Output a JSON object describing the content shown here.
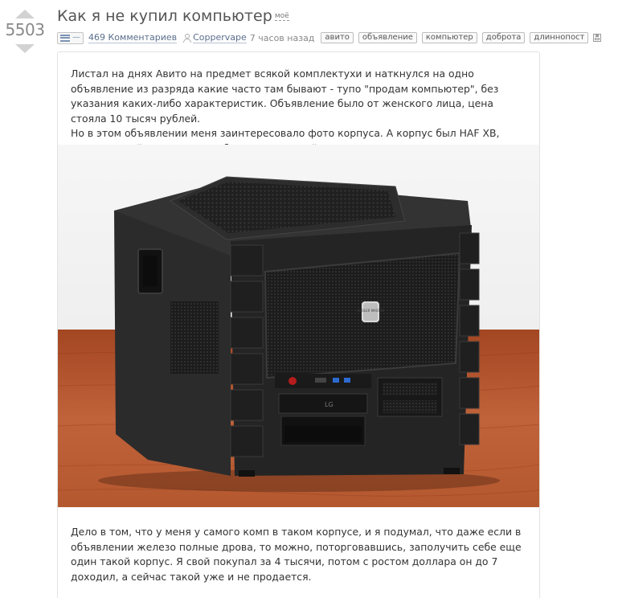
{
  "post": {
    "rating": "5503",
    "title": "Как я не купил компьютер",
    "mine_label": "моё",
    "comments_label": "469 Комментариев",
    "author": "Coppervape",
    "time": "7 часов назад",
    "tags": [
      "авито",
      "объявление",
      "компьютер",
      "доброта",
      "длиннопост"
    ],
    "toggle_symbol": "—"
  },
  "content": {
    "paragraph1": "Листал на днях Авито на предмет всякой комплектухи и наткнулся на одно объявление из разряда какие часто там бывают - тупо \"продам компьютер\", без указания каких-либо характеристик. Объявление было от женского лица, цена стояла 10 тысяч рублей.",
    "paragraph2": "Но в этом объявлении меня заинтересовало фото корпуса. А корпус был HAF XB, очень редкий формат, на любителя, вот такой",
    "paragraph3": "Дело в том, что у меня у самого комп в таком корпусе, и я подумал, что даже если в объявлении железо полные дрова, то можно, поторговавшись, заполучить себе еще один такой корпус. Я свой покупал за 4 тысячи, потом с ростом доллара он до 7 доходил, а сейчас такой уже и не продается."
  },
  "photo": {
    "logo_text": "COOLER MASTER",
    "drive_brand": "LG",
    "colors": {
      "wall": "#f3f3f3",
      "table": "#b5522c",
      "case": "#262626",
      "edge": "#3c3c3c"
    }
  },
  "icons": {
    "toggle": "lines-icon",
    "user": "user-icon",
    "save": "save-icon",
    "vote_up": "arrow-up-icon",
    "vote_down": "arrow-down-icon"
  }
}
